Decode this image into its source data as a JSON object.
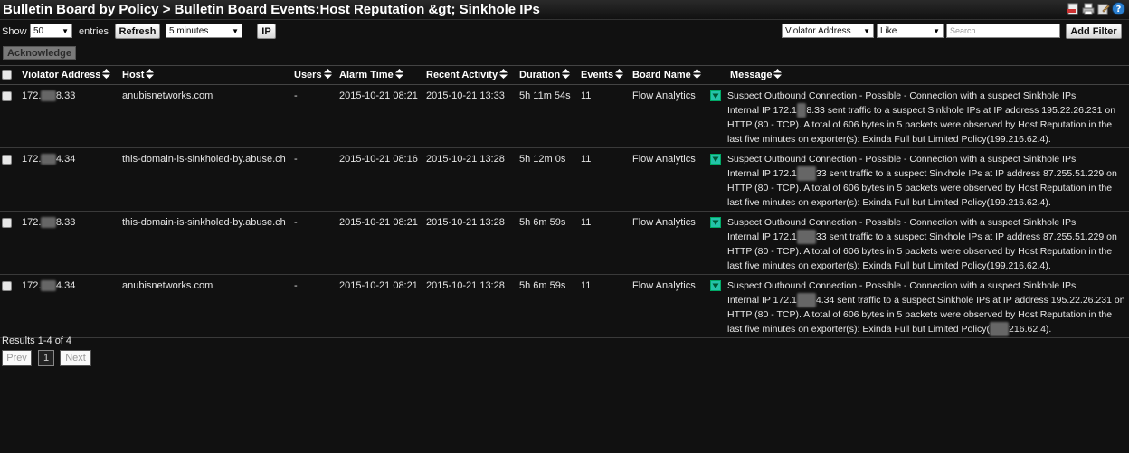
{
  "title": "Bulletin Board by Policy > Bulletin Board Events:Host Reputation &gt; Sinkhole IPs",
  "toolbar": {
    "show_label": "Show",
    "entries_value": "50",
    "entries_label": "entries",
    "refresh_label": "Refresh",
    "interval_value": "5 minutes",
    "ip_label": "IP",
    "filter_field_value": "Violator Address",
    "filter_op_value": "Like",
    "search_placeholder": "Search",
    "add_filter_label": "Add Filter",
    "acknowledge_label": "Acknowledge"
  },
  "columns": [
    "Violator Address",
    "Host",
    "Users",
    "Alarm Time",
    "Recent Activity",
    "Duration",
    "Events",
    "Board Name",
    "Message"
  ],
  "rows": [
    {
      "addr_pre": "172.",
      "addr_post": "8.33",
      "host": "anubisnetworks.com",
      "users": "-",
      "alarm": "2015-10-21 08:21",
      "recent": "2015-10-21 13:33",
      "duration": "5h 11m 54s",
      "events": "11",
      "board": "Flow Analytics",
      "msg1": "Suspect Outbound Connection - Possible - Connection with a suspect Sinkhole IPs",
      "msg2a": "Internal IP 172.1",
      "msg2b": "8.33 sent traffic to a suspect Sinkhole IPs at IP address 195.22.26.231 on",
      "msg3": "HTTP (80 - TCP). A total of 606 bytes in 5 packets were observed by Host Reputation in the",
      "msg4a": "last five minutes on exporter(s): Exinda Full but Limited Policy(199.216.62.4).",
      "msg4b": "",
      "msg4c": ""
    },
    {
      "addr_pre": "172.",
      "addr_post": "4.34",
      "host": "this-domain-is-sinkholed-by.abuse.ch",
      "users": "-",
      "alarm": "2015-10-21 08:16",
      "recent": "2015-10-21 13:28",
      "duration": "5h 12m 0s",
      "events": "11",
      "board": "Flow Analytics",
      "msg1": "Suspect Outbound Connection - Possible - Connection with a suspect Sinkhole IPs",
      "msg2a": "Internal IP 172.1",
      "msg2b": "33 sent traffic to a suspect Sinkhole IPs at IP address 87.255.51.229 on",
      "msg3": "HTTP (80 - TCP). A total of 606 bytes in 5 packets were observed by Host Reputation in the",
      "msg4a": "last five minutes on exporter(s): Exinda Full but Limited Policy(199.216.62.4).",
      "msg4b": "",
      "msg4c": ""
    },
    {
      "addr_pre": "172.",
      "addr_post": "8.33",
      "host": "this-domain-is-sinkholed-by.abuse.ch",
      "users": "-",
      "alarm": "2015-10-21 08:21",
      "recent": "2015-10-21 13:28",
      "duration": "5h 6m 59s",
      "events": "11",
      "board": "Flow Analytics",
      "msg1": "Suspect Outbound Connection - Possible - Connection with a suspect Sinkhole IPs",
      "msg2a": "Internal IP 172.1",
      "msg2b": "33 sent traffic to a suspect Sinkhole IPs at IP address 87.255.51.229 on",
      "msg3": "HTTP (80 - TCP). A total of 606 bytes in 5 packets were observed by Host Reputation in the",
      "msg4a": "last five minutes on exporter(s): Exinda Full but Limited Policy(199.216.62.4).",
      "msg4b": "",
      "msg4c": ""
    },
    {
      "addr_pre": "172.",
      "addr_post": "4.34",
      "host": "anubisnetworks.com",
      "users": "-",
      "alarm": "2015-10-21 08:21",
      "recent": "2015-10-21 13:28",
      "duration": "5h 6m 59s",
      "events": "11",
      "board": "Flow Analytics",
      "msg1": "Suspect Outbound Connection - Possible - Connection with a suspect Sinkhole IPs",
      "msg2a": "Internal IP 172.1",
      "msg2b": "4.34 sent traffic to a suspect Sinkhole IPs at IP address 195.22.26.231 on",
      "msg3": "HTTP (80 - TCP). A total of 606 bytes in 5 packets were observed by Host Reputation in the",
      "msg4a": "last five minutes on exporter(s): Exinda Full but Limited Policy(",
      "msg4b": "216.62.4).",
      "msg4c": ""
    }
  ],
  "results_label": "Results 1-4 of 4",
  "pager": {
    "prev": "Prev",
    "current": "1",
    "next": "Next"
  },
  "colors": {
    "accent": "#23c3a8",
    "background": "#111111"
  }
}
